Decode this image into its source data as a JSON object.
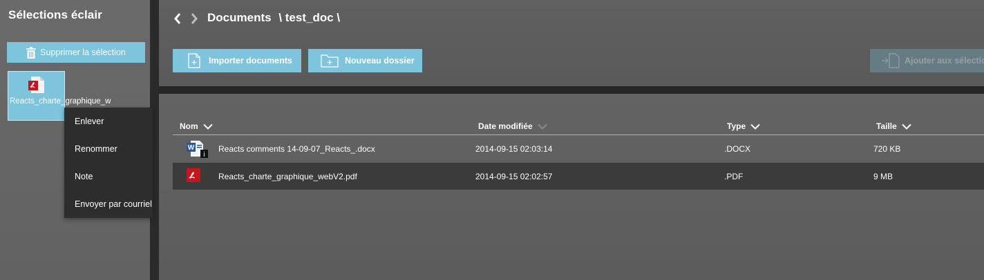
{
  "sidebar": {
    "title": "Sélections éclair",
    "clear_button": "Supprimer la sélection",
    "tile": {
      "name": "Reacts_charte_graphique_w",
      "icon": "pdf-icon"
    }
  },
  "context_menu": {
    "items": [
      "Enlever",
      "Renommer",
      "Note",
      "Envoyer par courriel"
    ]
  },
  "breadcrumb": {
    "parts": [
      "Documents",
      "\\ test_doc \\"
    ]
  },
  "toolbar": {
    "import_label": "Importer documents",
    "new_folder_label": "Nouveau dossier",
    "add_selection_label": "Ajouter aux sélectio"
  },
  "table": {
    "columns": {
      "name": "Nom",
      "date": "Date modifiée",
      "type": "Type",
      "size": "Taille"
    },
    "rows": [
      {
        "icon": "word-doc-icon",
        "name": "Reacts comments 14-09-07_Reacts_.docx",
        "date": "2014-09-15 02:03:14",
        "type": ".DOCX",
        "size": "720 KB"
      },
      {
        "icon": "pdf-icon",
        "name": "Reacts_charte_graphique_webV2.pdf",
        "date": "2014-09-15 02:02:57",
        "type": ".PDF",
        "size": "9 MB"
      }
    ]
  },
  "colors": {
    "accent": "#7ec4dd",
    "dark_divider": "#262626",
    "selected_row": "#3b3b3b",
    "pdf_red": "#c4161c",
    "word_blue": "#2b579a"
  }
}
